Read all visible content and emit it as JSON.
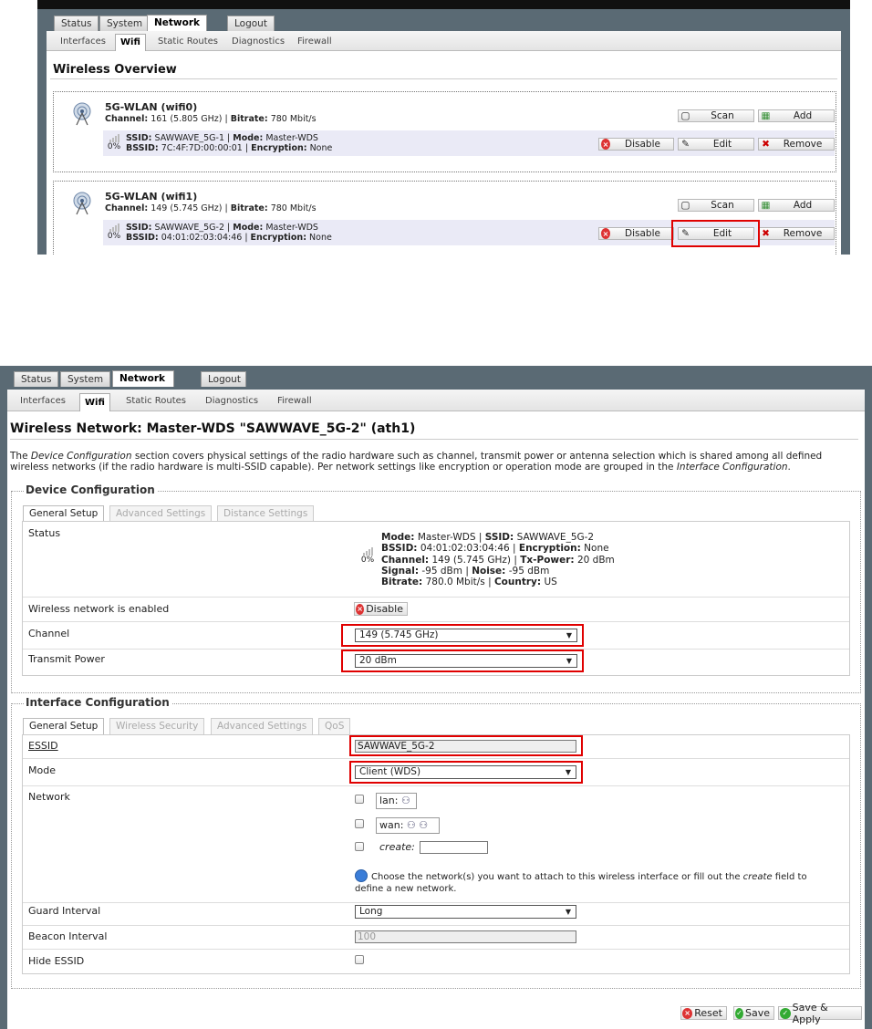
{
  "overview": {
    "tabs": [
      "Status",
      "System",
      "Network",
      "Logout"
    ],
    "subtabs": [
      "Interfaces",
      "Wifi",
      "Static Routes",
      "Diagnostics",
      "Firewall"
    ],
    "title": "Wireless Overview",
    "devices": [
      {
        "name": "5G-WLAN (wifi0)",
        "channel_label": "Channel:",
        "channel": "161 (5.805 GHz)",
        "bitrate_label": "Bitrate:",
        "bitrate": "780 Mbit/s",
        "ssid_label": "SSID:",
        "ssid": "SAWWAVE_5G-1",
        "mode_label": "Mode:",
        "mode": "Master-WDS",
        "bssid_label": "BSSID:",
        "bssid": "7C:4F:7D:00:00:01",
        "enc_label": "Encryption:",
        "enc": "None",
        "signal": "0%"
      },
      {
        "name": "5G-WLAN (wifi1)",
        "channel_label": "Channel:",
        "channel": "149 (5.745 GHz)",
        "bitrate_label": "Bitrate:",
        "bitrate": "780 Mbit/s",
        "ssid_label": "SSID:",
        "ssid": "SAWWAVE_5G-2",
        "mode_label": "Mode:",
        "mode": "Master-WDS",
        "bssid_label": "BSSID:",
        "bssid": "04:01:02:03:04:46",
        "enc_label": "Encryption:",
        "enc": "None",
        "signal": "0%"
      }
    ],
    "buttons": {
      "scan": "Scan",
      "add": "Add",
      "disable": "Disable",
      "edit": "Edit",
      "remove": "Remove"
    }
  },
  "editor": {
    "tabs": [
      "Status",
      "System",
      "Network",
      "Logout"
    ],
    "subtabs": [
      "Interfaces",
      "Wifi",
      "Static Routes",
      "Diagnostics",
      "Firewall"
    ],
    "title": "Wireless Network: Master-WDS \"SAWWAVE_5G-2\" (ath1)",
    "intro": {
      "p1": "The ",
      "em1": "Device Configuration",
      "p2": " section covers physical settings of the radio hardware such as channel, transmit power or antenna selection which is shared among all defined wireless networks (if the radio hardware is multi-SSID capable). Per network settings like encryption or operation mode are grouped in the ",
      "em2": "Interface Configuration",
      "p3": "."
    },
    "device_config": {
      "legend": "Device Configuration",
      "tabs": [
        "General Setup",
        "Advanced Settings",
        "Distance Settings"
      ],
      "status_label": "Status",
      "status": {
        "signal": "0%",
        "mode_label": "Mode:",
        "mode": "Master-WDS",
        "ssid_label": "SSID:",
        "ssid": "SAWWAVE_5G-2",
        "bssid_label": "BSSID:",
        "bssid": "04:01:02:03:04:46",
        "enc_label": "Encryption:",
        "enc": "None",
        "channel_label": "Channel:",
        "channel": "149 (5.745 GHz)",
        "txpower_label": "Tx-Power:",
        "txpower": "20 dBm",
        "signal_label": "Signal:",
        "signal_val": "-95 dBm",
        "noise_label": "Noise:",
        "noise": "-95 dBm",
        "bitrate_label": "Bitrate:",
        "bitrate": "780.0 Mbit/s",
        "country_label": "Country:",
        "country": "US"
      },
      "enabled_label": "Wireless network is enabled",
      "disable_btn": "Disable",
      "channel_label": "Channel",
      "channel_value": "149 (5.745 GHz)",
      "txpower_label": "Transmit Power",
      "txpower_value": "20 dBm"
    },
    "iface_config": {
      "legend": "Interface Configuration",
      "tabs": [
        "General Setup",
        "Wireless Security",
        "Advanced Settings",
        "QoS"
      ],
      "essid_label": "ESSID",
      "essid_value": "SAWWAVE_5G-2",
      "mode_label": "Mode",
      "mode_value": "Client (WDS)",
      "network_label": "Network",
      "networks": [
        "lan:",
        "wan:"
      ],
      "create_label": "create:",
      "help": {
        "p1": "Choose the network(s) you want to attach to this wireless interface or fill out the ",
        "em": "create",
        "p2": " field to define a new network."
      },
      "guard_label": "Guard Interval",
      "guard_value": "Long",
      "beacon_label": "Beacon Interval",
      "beacon_value": "100",
      "hide_label": "Hide ESSID"
    },
    "actions": {
      "reset": "Reset",
      "save": "Save",
      "save_apply": "Save & Apply"
    }
  },
  "colors": {
    "highlight": "#e00000",
    "frame": "#5a6a74"
  }
}
